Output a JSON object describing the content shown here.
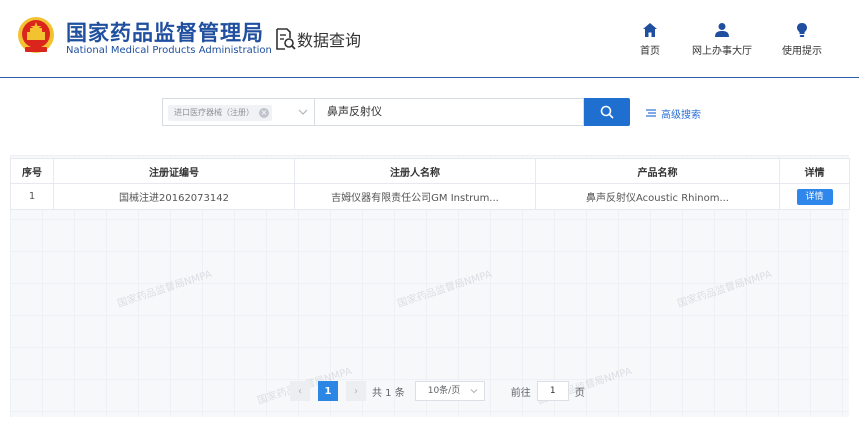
{
  "header": {
    "title_cn": "国家药品监督管理局",
    "title_en": "National Medical Products Administration",
    "section": "数据查询",
    "nav": [
      {
        "label": "首页",
        "icon": "home-icon"
      },
      {
        "label": "网上办事大厅",
        "icon": "user-icon"
      },
      {
        "label": "使用提示",
        "icon": "lightbulb-icon"
      }
    ]
  },
  "search": {
    "category_tag": "进口医疗器械（注册）",
    "query": "鼻声反射仪",
    "advanced_label": "高级搜索"
  },
  "table": {
    "columns": [
      "序号",
      "注册证编号",
      "注册人名称",
      "产品名称",
      "详情"
    ],
    "rows": [
      {
        "index": "1",
        "cert_no": "国械注进20162073142",
        "registrant": "吉姆仪器有限责任公司GM Instrum...",
        "product": "鼻声反射仪Acoustic Rhinom...",
        "detail_label": "详情"
      }
    ]
  },
  "watermark": "国家药品监督局NMPA",
  "pagination": {
    "current_page": "1",
    "total_text": "共 1 条",
    "page_size": "10条/页",
    "goto_label": "前往",
    "goto_value": "1",
    "page_unit": "页"
  },
  "colors": {
    "brand_blue": "#1f4f9e",
    "primary": "#1f6fd1",
    "emblem_red": "#d9251c",
    "emblem_gold": "#f2c230"
  }
}
